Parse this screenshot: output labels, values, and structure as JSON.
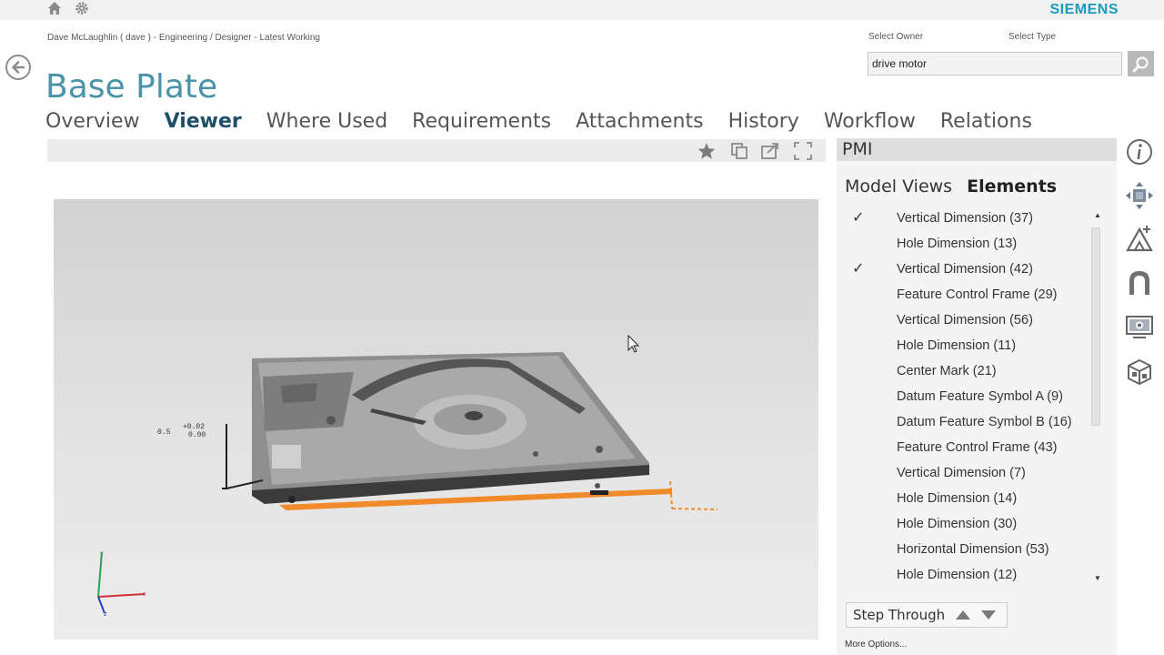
{
  "brand": "SIEMENS",
  "breadcrumb": "Dave McLaughlin ( dave ) - Engineering / Designer - Latest Working",
  "page_title": "Base Plate",
  "search": {
    "owner_label": "Select Owner",
    "type_label": "Select Type",
    "value": "drive motor"
  },
  "tabs": [
    "Overview",
    "Viewer",
    "Where Used",
    "Requirements",
    "Attachments",
    "History",
    "Workflow",
    "Relations"
  ],
  "active_tab": "Viewer",
  "viewer": {
    "annotation_text": "0.5",
    "annotation_tol_upper": "+0.02",
    "annotation_tol_lower": "0.00",
    "axis_labels": {
      "x": "x",
      "y": "y",
      "z": "z"
    }
  },
  "pmi": {
    "header": "PMI",
    "subtabs": [
      "Model Views",
      "Elements"
    ],
    "active_subtab": "Elements",
    "items": [
      {
        "label": "Vertical Dimension (37)",
        "checked": "✓"
      },
      {
        "label": "Hole Dimension (13)",
        "checked": ""
      },
      {
        "label": "Vertical Dimension (42)",
        "checked": "✓"
      },
      {
        "label": "Feature Control Frame (29)",
        "checked": ""
      },
      {
        "label": "Vertical Dimension (56)",
        "checked": ""
      },
      {
        "label": "Hole Dimension (11)",
        "checked": ""
      },
      {
        "label": "Center Mark (21)",
        "checked": ""
      },
      {
        "label": "Datum Feature Symbol A (9)",
        "checked": ""
      },
      {
        "label": "Datum Feature Symbol B (16)",
        "checked": ""
      },
      {
        "label": "Feature Control Frame (43)",
        "checked": ""
      },
      {
        "label": "Vertical Dimension (7)",
        "checked": ""
      },
      {
        "label": "Hole Dimension (14)",
        "checked": ""
      },
      {
        "label": "Hole Dimension (30)",
        "checked": ""
      },
      {
        "label": "Horizontal Dimension (53)",
        "checked": ""
      },
      {
        "label": "Hole Dimension (12)",
        "checked": ""
      }
    ],
    "step_through_label": "Step Through",
    "more_options_label": "More Options..."
  },
  "colors": {
    "accent": "#4a93a8",
    "tab_active": "#1f4e68",
    "brand": "#1a9bbb",
    "highlight": "#f08a2a"
  },
  "icons": {
    "topbar": [
      "home-icon",
      "gear-icon"
    ],
    "toolbar": [
      "star-icon",
      "copy-icon",
      "share-icon",
      "fullscreen-icon"
    ],
    "side_tools": [
      "info-icon",
      "move-icon",
      "measure-icon",
      "section-icon",
      "snapshot-icon",
      "model-icon"
    ]
  }
}
